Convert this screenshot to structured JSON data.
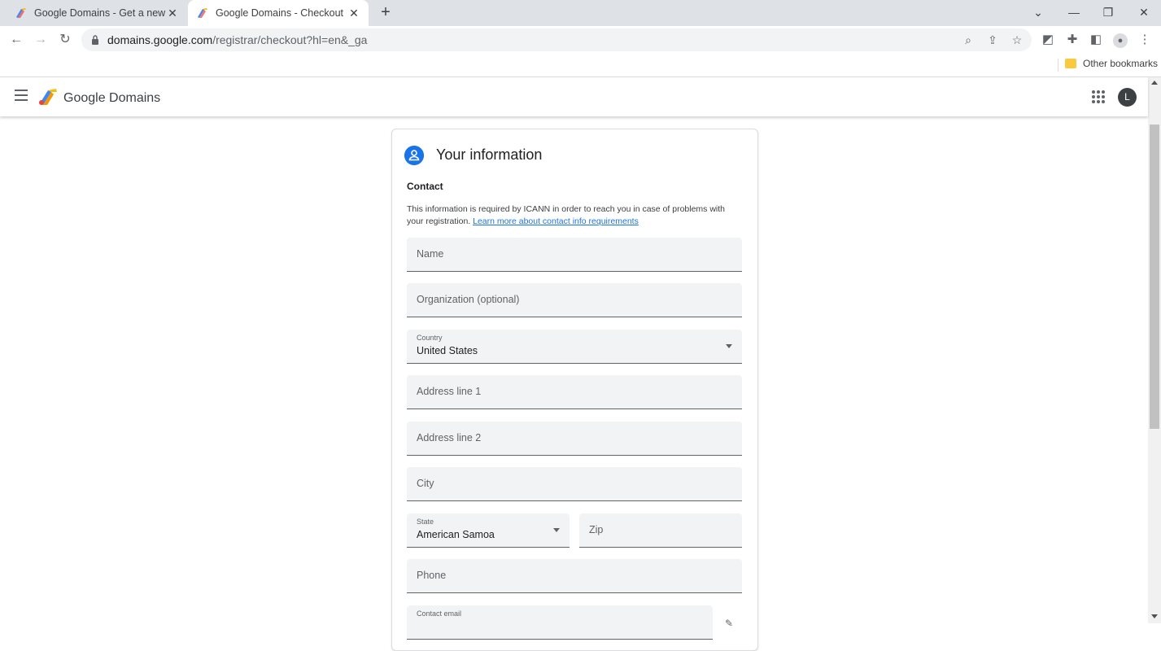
{
  "browser": {
    "tabs": [
      {
        "title": "Google Domains - Get a new domain",
        "active": false
      },
      {
        "title": "Google Domains - Checkout",
        "active": true
      }
    ],
    "url_host": "domains.google.com",
    "url_path": "/registrar/checkout?hl=en&_ga",
    "bookmarks": {
      "other": "Other bookmarks"
    },
    "profile_initial": "L"
  },
  "app": {
    "name": "Google Domains",
    "avatar_initial": "L"
  },
  "card": {
    "title": "Your information",
    "section": "Contact",
    "info_text": "This information is required by ICANN in order to reach you in case of problems with your registration.",
    "info_link": "Learn more about contact info requirements"
  },
  "form": {
    "name_placeholder": "Name",
    "organization_placeholder": "Organization (optional)",
    "country_label": "Country",
    "country_value": "United States",
    "address1_placeholder": "Address line 1",
    "address2_placeholder": "Address line 2",
    "city_placeholder": "City",
    "state_label": "State",
    "state_value": "American Samoa",
    "zip_placeholder": "Zip",
    "phone_placeholder": "Phone",
    "email_label": "Contact email"
  },
  "colors": {
    "accent": "#1a73e8",
    "field_bg": "#f1f3f4",
    "tabstrip": "#dee1e6"
  }
}
